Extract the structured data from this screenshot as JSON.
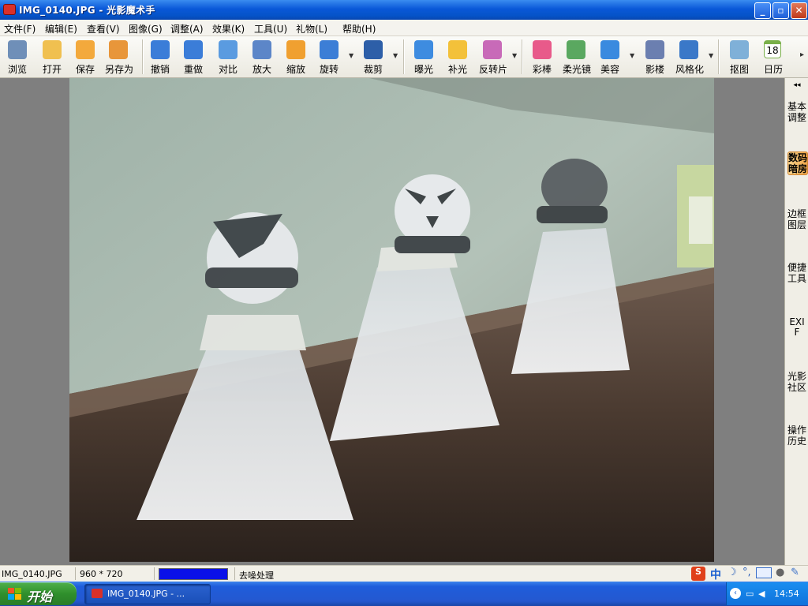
{
  "window": {
    "title": "IMG_0140.JPG - 光影魔术手"
  },
  "menu": [
    "文件(F)",
    "编辑(E)",
    "查看(V)",
    "图像(G)",
    "调整(A)",
    "效果(K)",
    "工具(U)",
    "礼物(L)",
    "帮助(H)"
  ],
  "toolbar": [
    {
      "label": "浏览",
      "icon": "eye-icon",
      "color": "#6f8fb8"
    },
    {
      "label": "打开",
      "icon": "folder-open-icon",
      "color": "#f0c050"
    },
    {
      "label": "保存",
      "icon": "save-icon",
      "color": "#f3a93c"
    },
    {
      "label": "另存为",
      "icon": "save-as-icon",
      "color": "#e8963a"
    },
    {
      "label": "撤销",
      "icon": "undo-icon",
      "color": "#3b7dd8"
    },
    {
      "label": "重做",
      "icon": "redo-icon",
      "color": "#3b7dd8"
    },
    {
      "label": "对比",
      "icon": "compare-icon",
      "color": "#5a9be0"
    },
    {
      "label": "放大",
      "icon": "zoom-in-icon",
      "color": "#5c86c8"
    },
    {
      "label": "缩放",
      "icon": "resize-icon",
      "color": "#f0a030"
    },
    {
      "label": "旋转",
      "icon": "rotate-icon",
      "color": "#3c7ed6"
    },
    {
      "label": "裁剪",
      "icon": "crop-icon",
      "color": "#2d5fa8"
    },
    {
      "label": "曝光",
      "icon": "exposure-icon",
      "color": "#3e8ce0"
    },
    {
      "label": "补光",
      "icon": "fill-light-icon",
      "color": "#f3c13a"
    },
    {
      "label": "反转片",
      "icon": "reversal-film-icon",
      "color": "#c86ab8"
    },
    {
      "label": "彩棒",
      "icon": "color-wand-icon",
      "color": "#e85a8a"
    },
    {
      "label": "柔光镜",
      "icon": "soft-focus-icon",
      "color": "#5aa860"
    },
    {
      "label": "美容",
      "icon": "beauty-icon",
      "color": "#3a8adf"
    },
    {
      "label": "影楼",
      "icon": "studio-icon",
      "color": "#6b7fb0"
    },
    {
      "label": "风格化",
      "icon": "stylize-icon",
      "color": "#3a78c8"
    },
    {
      "label": "抠图",
      "icon": "cutout-icon",
      "color": "#7fb0d8"
    },
    {
      "label": "日历",
      "icon": "calendar-icon",
      "color": "#7ab04a",
      "badge": "18"
    }
  ],
  "right_panel": {
    "collapse": "◂◂",
    "tabs": [
      {
        "label": "基本调整",
        "active": false
      },
      {
        "label": "数码暗房",
        "active": true
      },
      {
        "label": "边框图层",
        "active": false
      },
      {
        "label": "便捷工具",
        "active": false
      },
      {
        "label": "EXIF",
        "active": false
      },
      {
        "label": "光影社区",
        "active": false
      },
      {
        "label": "操作历史",
        "active": false
      }
    ]
  },
  "status": {
    "filename": "IMG_0140.JPG",
    "dimensions": "960 * 720",
    "progress": 1.0,
    "message": "去噪处理"
  },
  "taskbar": {
    "start": "开始",
    "task": "IMG_0140.JPG - ...",
    "clock": "14:54"
  }
}
